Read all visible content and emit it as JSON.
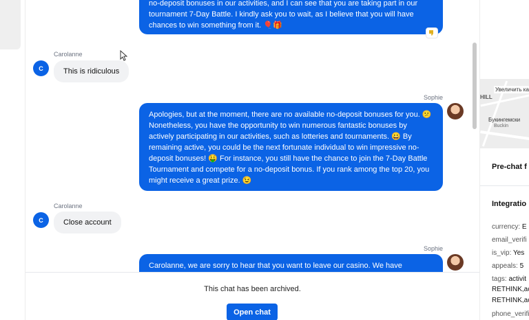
{
  "conversation": {
    "messages": [
      {
        "role": "agent",
        "sender": "",
        "lines": [
          "no-deposit bonuses in our activities, and I can see that you are taking part in our",
          "tournament 7-Day Battle. I kindly ask you to wait, as I believe that you will have",
          "chances to win something from it. 🎈🎁"
        ]
      },
      {
        "role": "user",
        "sender": "Carolanne",
        "text": "This is ridiculous",
        "avatar_initial": "C"
      },
      {
        "role": "agent",
        "sender": "Sophie",
        "lines": [
          "Apologies, but at the moment, there are no available no-deposit bonuses for you. 😕",
          "Nonetheless, you have the opportunity to win numerous fantastic bonuses by",
          "actively participating in our activities, such as lotteries and tournaments. 😀 By",
          "remaining active, you could be the next fortunate individual to win impressive no-",
          "deposit bonuses! 🤑 For instance, you still have the chance to join the 7-Day Battle",
          "Tournament and compete for a no-deposit bonus. If you rank among the top 20, you",
          "might receive a great prize. 😉"
        ]
      },
      {
        "role": "user",
        "sender": "Carolanne",
        "text": "Close account",
        "avatar_initial": "C"
      },
      {
        "role": "agent",
        "sender": "Sophie",
        "lines": [
          "Carolanne, we are sorry to hear that you want to leave our casino. We have"
        ]
      }
    ],
    "reaction_icon": "thumbs-down-icon"
  },
  "footer": {
    "archived_text": "This chat has been archived.",
    "open_chat_label": "Open chat"
  },
  "right_panel": {
    "map": {
      "zoom_hint": "Увеличить ка",
      "label_hill": "HILL",
      "label_palace": "Букингемски",
      "label_palace_en": "Buckin"
    },
    "prechat_title": "Pre-chat f",
    "integration_title": "Integratio",
    "fields": [
      {
        "key": "currency:",
        "value": "E"
      },
      {
        "key": "email_verifi",
        "value": ""
      },
      {
        "key": "is_vip:",
        "value": "Yes"
      },
      {
        "key": "appeals:",
        "value": "5"
      },
      {
        "key": "tags:",
        "value": "activit"
      },
      {
        "key": "",
        "value": "RETHINK,ac"
      },
      {
        "key": "",
        "value": "RETHINK,ac"
      },
      {
        "key": "phone_verifi",
        "value": ""
      }
    ]
  },
  "colors": {
    "accent": "#0b63e5",
    "user_bubble": "#f1f2f4"
  }
}
